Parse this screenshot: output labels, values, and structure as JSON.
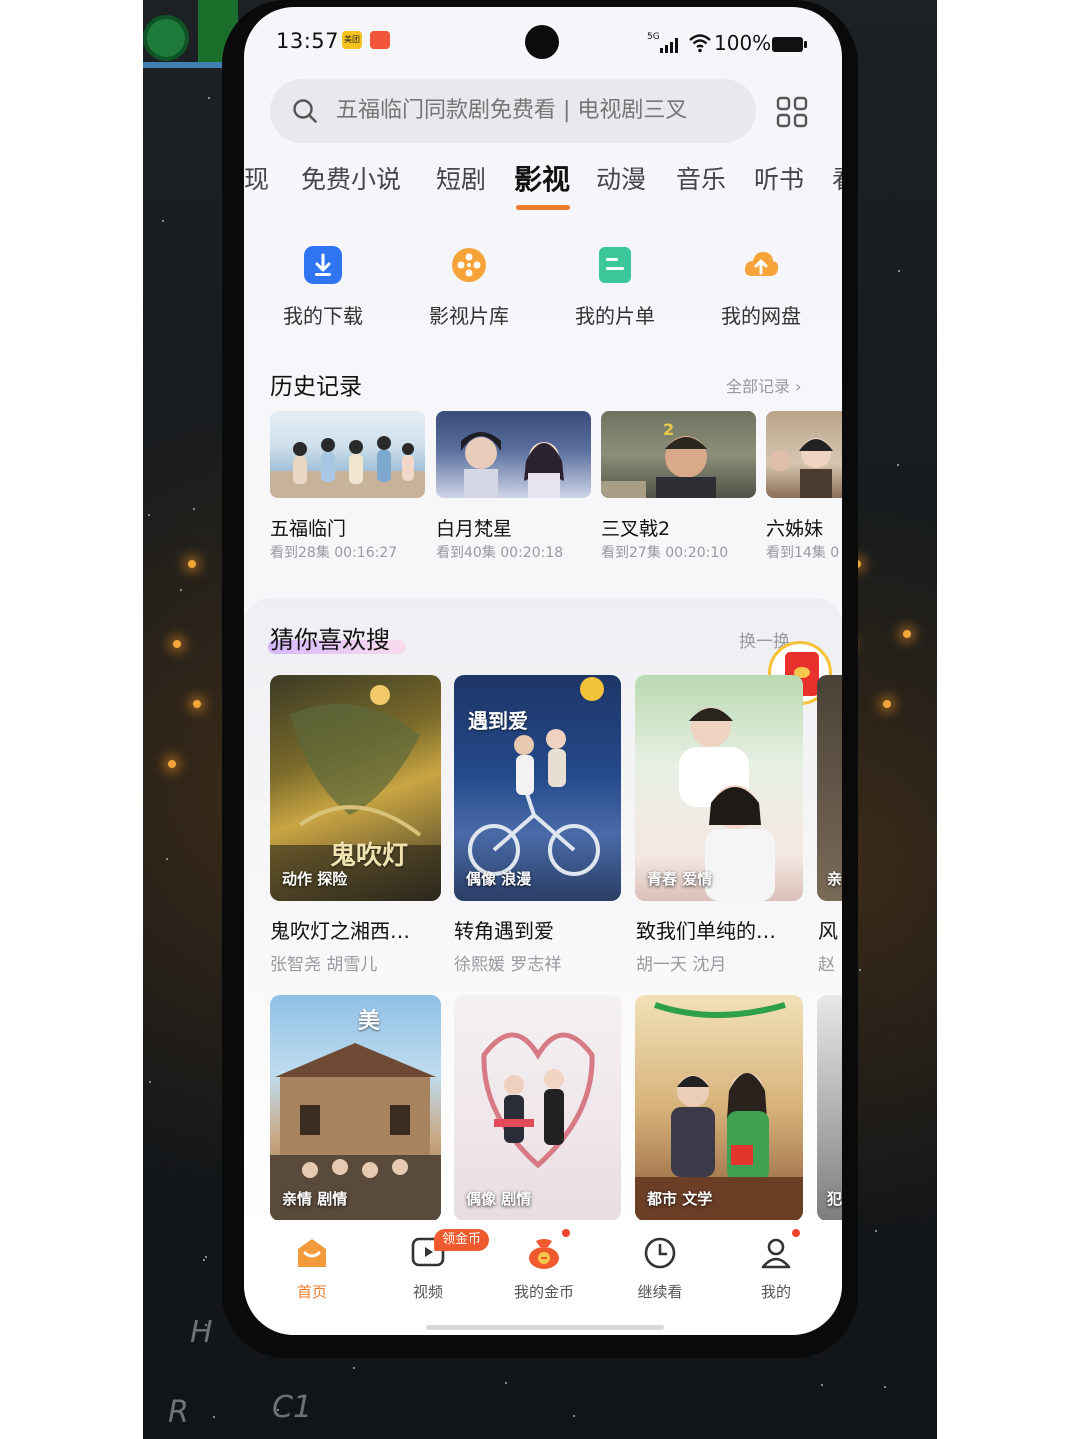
{
  "status_bar": {
    "time": "13:57",
    "app_icon_1": "美团",
    "app_icon_2": "",
    "network": "5G",
    "battery": "100%"
  },
  "search": {
    "placeholder": "五福临门同款剧免费看 | 电视剧三叉"
  },
  "tabs": [
    {
      "label": "现"
    },
    {
      "label": "免费小说"
    },
    {
      "label": "短剧"
    },
    {
      "label": "影视",
      "active": true
    },
    {
      "label": "动漫"
    },
    {
      "label": "音乐"
    },
    {
      "label": "听书"
    },
    {
      "label": "看"
    }
  ],
  "shortcuts": [
    {
      "label": "我的下载",
      "icon": "download-icon",
      "color": "#2f74f0"
    },
    {
      "label": "影视片库",
      "icon": "film-reel-icon",
      "color": "#f6a33a"
    },
    {
      "label": "我的片单",
      "icon": "playlist-icon",
      "color": "#3cc79b"
    },
    {
      "label": "我的网盘",
      "icon": "cloud-upload-icon",
      "color": "#f6a33a"
    }
  ],
  "history": {
    "title": "历史记录",
    "more": "全部记录 ›",
    "items": [
      {
        "title": "五福临门",
        "progress": "看到28集 00:16:27"
      },
      {
        "title": "白月梵星",
        "progress": "看到40集 00:20:18"
      },
      {
        "title": "三叉戟2",
        "progress": "看到27集 00:20:10"
      },
      {
        "title": "六姊妹",
        "progress": "看到14集 0"
      }
    ]
  },
  "recommend": {
    "title": "猜你喜欢搜",
    "more": "换一换",
    "items": [
      {
        "title": "鬼吹灯之湘西…",
        "cast": "张智尧 胡雪儿",
        "tags": "动作 探险",
        "poster_text": "鬼吹灯"
      },
      {
        "title": "转角遇到爱",
        "cast": "徐熙媛 罗志祥",
        "tags": "偶像 浪漫",
        "poster_text": "遇到爱"
      },
      {
        "title": "致我们单纯的…",
        "cast": "胡一天 沈月",
        "tags": "青春 爱情",
        "poster_text": ""
      },
      {
        "title": "风",
        "cast": "赵",
        "tags": "亲",
        "poster_text": ""
      },
      {
        "title": "",
        "cast": "",
        "tags": "亲情 剧情",
        "poster_text": "美"
      },
      {
        "title": "",
        "cast": "",
        "tags": "偶像 剧情",
        "poster_text": ""
      },
      {
        "title": "",
        "cast": "",
        "tags": "都市 文学",
        "poster_text": ""
      },
      {
        "title": "",
        "cast": "",
        "tags": "犯",
        "poster_text": ""
      }
    ]
  },
  "bottom_nav": {
    "badge": "领金币",
    "items": [
      {
        "label": "首页",
        "icon": "home-icon",
        "active": true
      },
      {
        "label": "视频",
        "icon": "video-play-icon"
      },
      {
        "label": "我的金币",
        "icon": "coin-pot-icon"
      },
      {
        "label": "继续看",
        "icon": "clock-icon"
      },
      {
        "label": "我的",
        "icon": "profile-icon"
      }
    ]
  },
  "colors": {
    "accent": "#f07a2e",
    "text_primary": "#111111",
    "text_secondary": "#9a9a9e"
  }
}
